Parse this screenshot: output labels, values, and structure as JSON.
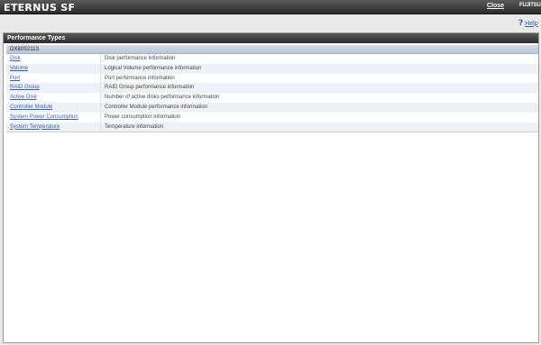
{
  "header": {
    "brand": "ETERNUS SF",
    "close_label": "Close",
    "vendor": "FUJITSU"
  },
  "help": {
    "icon": "?",
    "label": "Help"
  },
  "panel": {
    "title": "Performance Types",
    "device": "DX80S2113",
    "rows": [
      {
        "link": "Disk",
        "desc": "Disk performance information"
      },
      {
        "link": "Volume",
        "desc": "Logical Volume performance information"
      },
      {
        "link": "Port",
        "desc": "Port performance information"
      },
      {
        "link": "RAID Group",
        "desc": "RAID Group performance information"
      },
      {
        "link": "Active Disk",
        "desc": "Number of active disks performance information"
      },
      {
        "link": "Controller Module",
        "desc": "Controller Module performance information"
      },
      {
        "link": "System Power Consumption",
        "desc": "Power consumption information"
      },
      {
        "link": "System Temperature",
        "desc": "Temperature information"
      }
    ]
  }
}
